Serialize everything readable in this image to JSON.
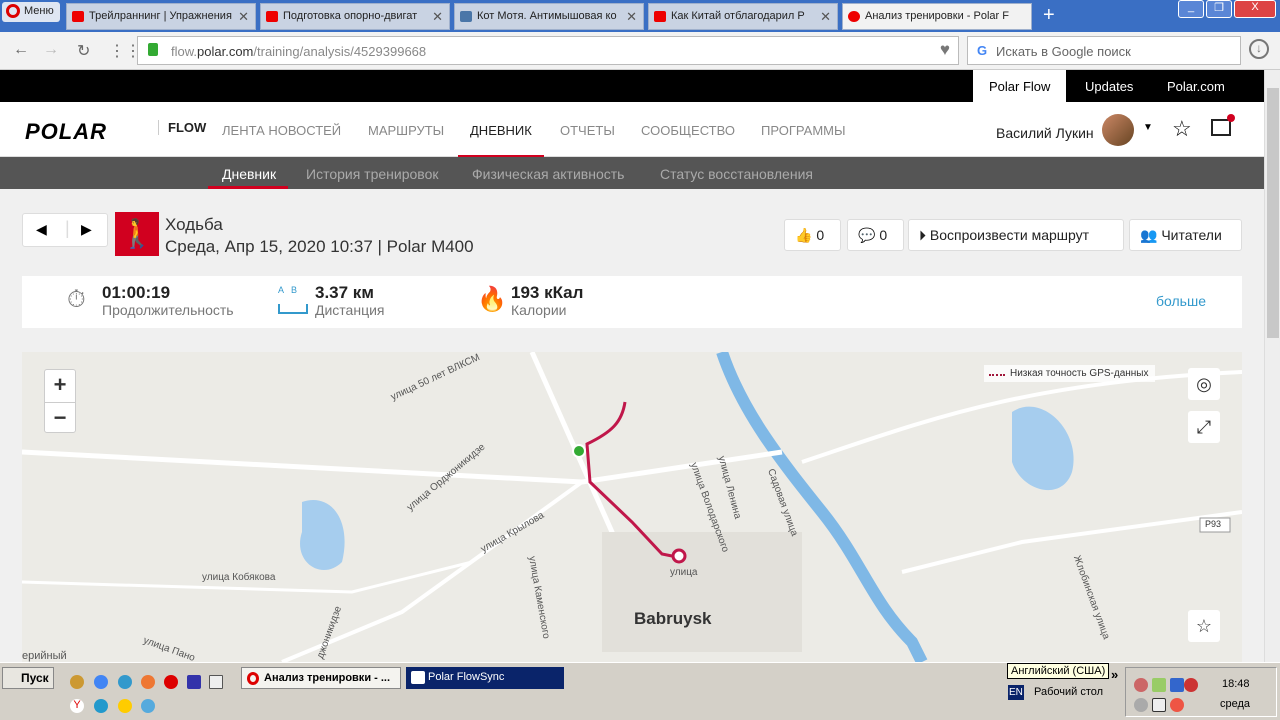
{
  "browser": {
    "menu": "Меню",
    "tabs": [
      {
        "title": "Трейлраннинг | Упражнения",
        "color": "#e00"
      },
      {
        "title": "Подготовка опорно-двигат",
        "color": "#e00"
      },
      {
        "title": "Кот Мотя. Антимышовая ко",
        "color": "#4a76a8"
      },
      {
        "title": "Как Китай отблагодарил Р",
        "color": "#e00"
      },
      {
        "title": "Анализ тренировки - Polar F",
        "color": "#d1001f"
      }
    ],
    "url_pre": "flow.",
    "url_host": "polar.com",
    "url_path": "/training/analysis/4529399668",
    "search_placeholder": "Искать в Google поиск"
  },
  "topbar": [
    "Polar Flow",
    "Updates",
    "Polar.com"
  ],
  "nav": {
    "logo": "POLAR",
    "flow": "FLOW",
    "items": [
      "ЛЕНТА НОВОСТЕЙ",
      "МАРШРУТЫ",
      "ДНЕВНИК",
      "ОТЧЕТЫ",
      "СООБЩЕСТВО",
      "ПРОГРАММЫ"
    ],
    "active": 2,
    "user": "Василий Лукин"
  },
  "subnav": [
    "Дневник",
    "История тренировок",
    "Физическая активность",
    "Статус восстановления"
  ],
  "training": {
    "sport": "Ходьба",
    "subtitle": "Среда, Апр 15, 2020 10:37 | Polar M400",
    "likes": "0",
    "comments": "0",
    "replay": "Воспроизвести маршрут",
    "followers": "Читатели"
  },
  "stats": {
    "duration": "01:00:19",
    "duration_label": "Продолжительность",
    "ab": "A   B",
    "distance": "3.37 км",
    "distance_label": "Дистанция",
    "calories": "193 кКал",
    "calories_label": "Калории",
    "more": "больше"
  },
  "map": {
    "legend": "Низкая точность GPS-данных",
    "city": "Babruysk",
    "road": "P93",
    "streets": [
      "улица 50 лет ВЛКСМ",
      "улица Орджоникидзе",
      "улица Крылова",
      "улица Кобякова",
      "улица Каменского",
      "улица Володарского",
      "улица Ленина",
      "Садовая улица",
      "Жлобинская улица",
      "улица Пано",
      "джоникидзе",
      "улица",
      "ерийный"
    ]
  },
  "taskbar": {
    "start": "Пуск",
    "tasks": [
      "Анализ тренировки - ...",
      "Polar FlowSync"
    ],
    "lang_tooltip": "Английский (США)",
    "lang": "EN",
    "desktop": "Рабочий стол",
    "time": "18:48",
    "day": "среда"
  }
}
